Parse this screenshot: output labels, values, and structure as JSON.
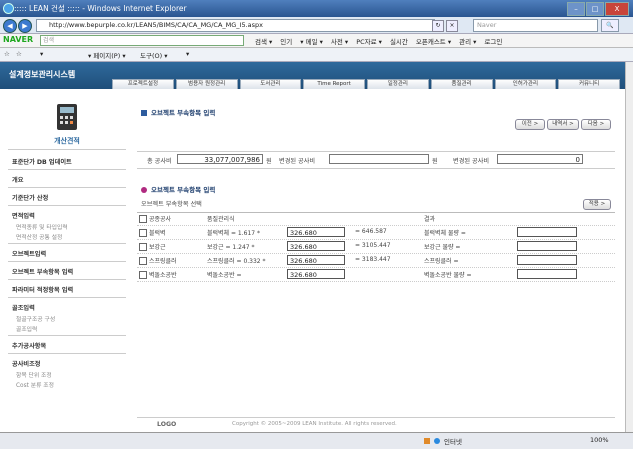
{
  "window": {
    "title": "::::: LEAN 건설 ::::: - Windows Internet Explorer",
    "minimize": "–",
    "maximize": "□",
    "close": "X"
  },
  "address": {
    "back": "◀",
    "forward": "▶",
    "url": "http://www.bepurple.co.kr/LEAN5/BIMS/CA/CA_MG/CA_MG_I5.aspx",
    "search_placeholder": "Naver",
    "search_go": "🔍"
  },
  "naver": {
    "logo": "NAVER",
    "input": "검색",
    "items": [
      "검색 ▾",
      "인기",
      "▾ 메일 ▾",
      "사전 ▾",
      "PC자료 ▾",
      "실시간",
      "오픈캐스트 ▾",
      "관리 ▾",
      "로그인"
    ]
  },
  "favbar": {
    "items": [
      "☆",
      "☆",
      "▾",
      "▾ 페이지(P) ▾",
      "도구(O) ▾",
      "▾"
    ]
  },
  "site": {
    "logo": "설계정보관리시스템",
    "menu": [
      "프로젝트설정",
      "범용자 원정관리",
      "도서관리",
      "Time Report",
      "일정관리",
      "품질관리",
      "인허가관리",
      "커뮤니티"
    ]
  },
  "sidebar": {
    "calc_label": "개산견적",
    "items": [
      {
        "label": "표준단가 DB 업데이트",
        "subs": []
      },
      {
        "label": "개요",
        "subs": []
      },
      {
        "label": "기준단가 산정",
        "subs": []
      },
      {
        "label": "면적입력",
        "subs": [
          "면적종류 및 타입입력",
          "면적산정 공통 설정"
        ]
      },
      {
        "label": "오브젝트입력",
        "subs": []
      },
      {
        "label": "오브젝트 부속항목 입력",
        "subs": []
      },
      {
        "label": "파라미터 적정항목 입력",
        "subs": []
      },
      {
        "label": "골조입력",
        "subs": [
          "철골구조공 구성",
          "골조입력"
        ]
      },
      {
        "label": "추가공사항목",
        "subs": []
      },
      {
        "label": "공사비조정",
        "subs": [
          "항목 단위 조정",
          "Cost 분류 조정"
        ]
      }
    ]
  },
  "main": {
    "section1": "오브젝트 부속항목 입력",
    "buttons": [
      "이전 >",
      "내역서 >",
      "다음 >"
    ],
    "sum": {
      "total_label": "총 공사비",
      "total_value": "33,077,007,986",
      "total_unit": "원",
      "changed_label": "변경된 공사비",
      "changed_unit": "원",
      "diff_label": "변경된 공사비",
      "diff_value": "0"
    },
    "section2": "오브젝트 부속항목 입력",
    "select_label": "오브젝트 부속항목 선택",
    "apply_button": "적용 >",
    "col_headers": [
      "공종공사",
      "품질관리식",
      "결과"
    ],
    "rows": [
      {
        "name": "블럭벽",
        "formula": "블럭벽체 = 1.617 *",
        "value": "326.680",
        "result": "= 646.587",
        "result_label": "블럭벽체 물량 ="
      },
      {
        "name": "보강근",
        "formula": "보강근 = 1.247 *",
        "value": "326.680",
        "result": "= 3105.447",
        "result_label": "보강근 물량 ="
      },
      {
        "name": "스프링클러",
        "formula": "스프링클러 = 0.332 *",
        "value": "326.680",
        "result": "= 3183.447",
        "result_label": "스프링클러 ="
      },
      {
        "name": "벽돌소공반",
        "formula": "벽돌소공반 =",
        "value": "326.680",
        "result": "",
        "result_label": "벽돌소공반 물량 ="
      }
    ]
  },
  "footer": {
    "logo": "LOGO",
    "copyright": "Copyright © 2005~2009 LEAN Institute. All rights reserved."
  },
  "status": {
    "zone": "인터넷",
    "zoom": "100%"
  }
}
